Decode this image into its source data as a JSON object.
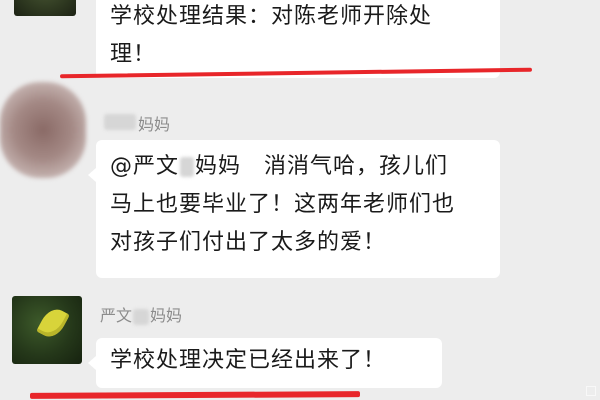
{
  "chat": {
    "messages": [
      {
        "sender": "",
        "lines": [
          "学校处理结果：对陈老师开除处",
          "理！"
        ]
      },
      {
        "sender": "妈妈",
        "lines": [
          "@严文",
          "妈妈　消消气哈，孩儿们",
          "马上也要毕业了！这两年老师们也",
          "对孩子们付出了太多的爱！"
        ]
      },
      {
        "sender": "严文",
        "sender_suffix": "妈妈",
        "lines": [
          "学校处理决定已经出来了！"
        ]
      }
    ]
  },
  "colors": {
    "background": "#ededed",
    "bubble": "#ffffff",
    "underline": "#e8262a",
    "name": "#8c8c8c"
  },
  "icons": {
    "avatar_top": "avatar-dark-icon",
    "avatar_blur": "avatar-blurred-icon",
    "avatar_leaf": "avatar-leaf-icon"
  }
}
